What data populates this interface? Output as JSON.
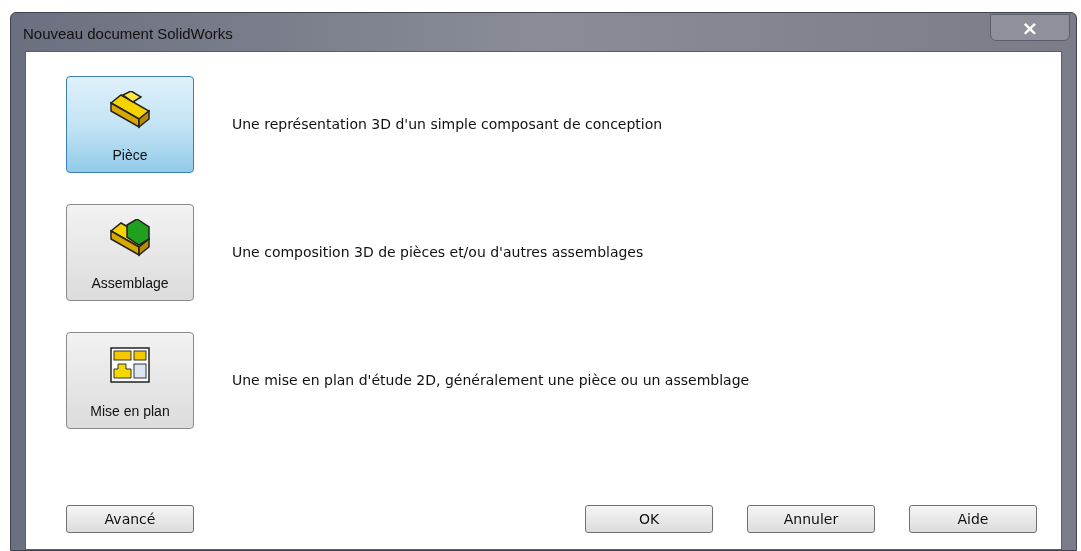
{
  "window": {
    "title": "Nouveau document SolidWorks",
    "close": "×"
  },
  "templates": [
    {
      "kind": "part",
      "label": "Pièce",
      "description": "Une représentation 3D d'un simple composant de conception",
      "selected": true
    },
    {
      "kind": "assembly",
      "label": "Assemblage",
      "description": "Une composition 3D de pièces et/ou d'autres assemblages",
      "selected": false
    },
    {
      "kind": "drawing",
      "label": "Mise en plan",
      "description": "Une mise en plan d'étude 2D, généralement une pièce ou un assemblage",
      "selected": false
    }
  ],
  "buttons_left": [
    "Avancé"
  ],
  "buttons_right": [
    "OK",
    "Annuler",
    "Aide"
  ]
}
